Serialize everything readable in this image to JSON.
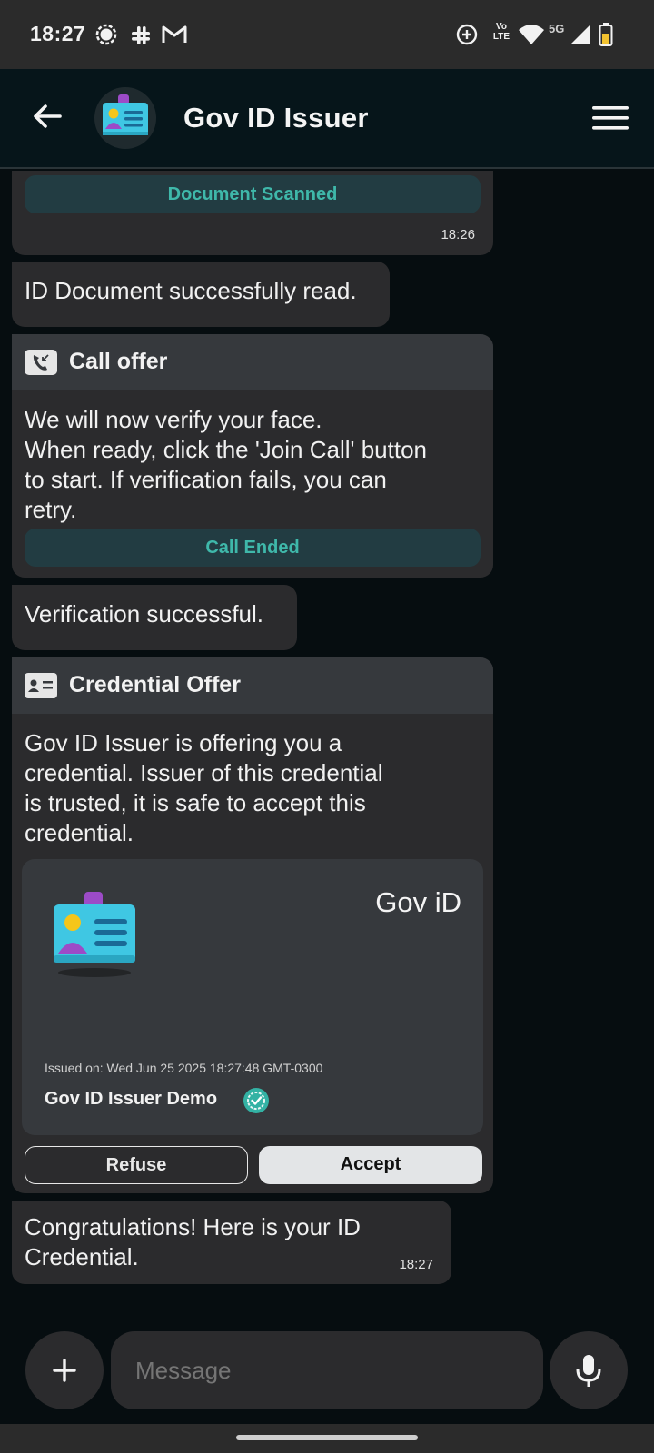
{
  "status_bar": {
    "time": "18:27",
    "left_icons": [
      "signal-app-icon",
      "slack-icon",
      "gmail-icon"
    ],
    "right_icons": [
      "data-saver-icon",
      "volte-icon",
      "wifi-icon",
      "5g-icon",
      "cell-signal-icon",
      "battery-icon"
    ],
    "volte_label": "Vo LTE",
    "network_label": "5G"
  },
  "header": {
    "title": "Gov ID Issuer",
    "back_icon": "arrow-left-icon",
    "menu_icon": "hamburger-menu-icon",
    "avatar_icon": "id-card-icon"
  },
  "messages": {
    "scanned": {
      "pill": "Document Scanned",
      "time": "18:26"
    },
    "doc_read": {
      "text": "ID Document successfully read."
    },
    "call_offer": {
      "title": "Call offer",
      "icon": "incoming-call-icon",
      "lines": [
        "We will now verify your face.",
        "When ready, click the 'Join Call' button",
        "to start. If verification fails, you can",
        "retry."
      ],
      "pill": "Call Ended"
    },
    "verified": {
      "text": "Verification successful."
    },
    "credential_offer": {
      "title": "Credential Offer",
      "icon": "contact-card-icon",
      "lines": [
        "Gov ID Issuer is offering you a",
        "credential. Issuer of this credential",
        "is trusted, it is safe to accept this",
        "credential."
      ],
      "card": {
        "name": "Gov iD",
        "issued": "Issued on: Wed Jun 25 2025 18:27:48 GMT-0300",
        "issuer": "Gov ID Issuer Demo",
        "verified_icon": "verified-badge-icon"
      },
      "refuse": "Refuse",
      "accept": "Accept"
    },
    "congrats": {
      "lines": [
        "Congratulations! Here is your ID",
        "Credential."
      ],
      "time": "18:27"
    }
  },
  "composer": {
    "placeholder": "Message",
    "add_icon": "plus-icon",
    "mic_icon": "microphone-icon"
  },
  "colors": {
    "background": "#060d10",
    "bubble": "#2b2b2d",
    "card_header": "#36393d",
    "accent_teal": "#3fb8aa",
    "pill_bg": "#223c42"
  }
}
